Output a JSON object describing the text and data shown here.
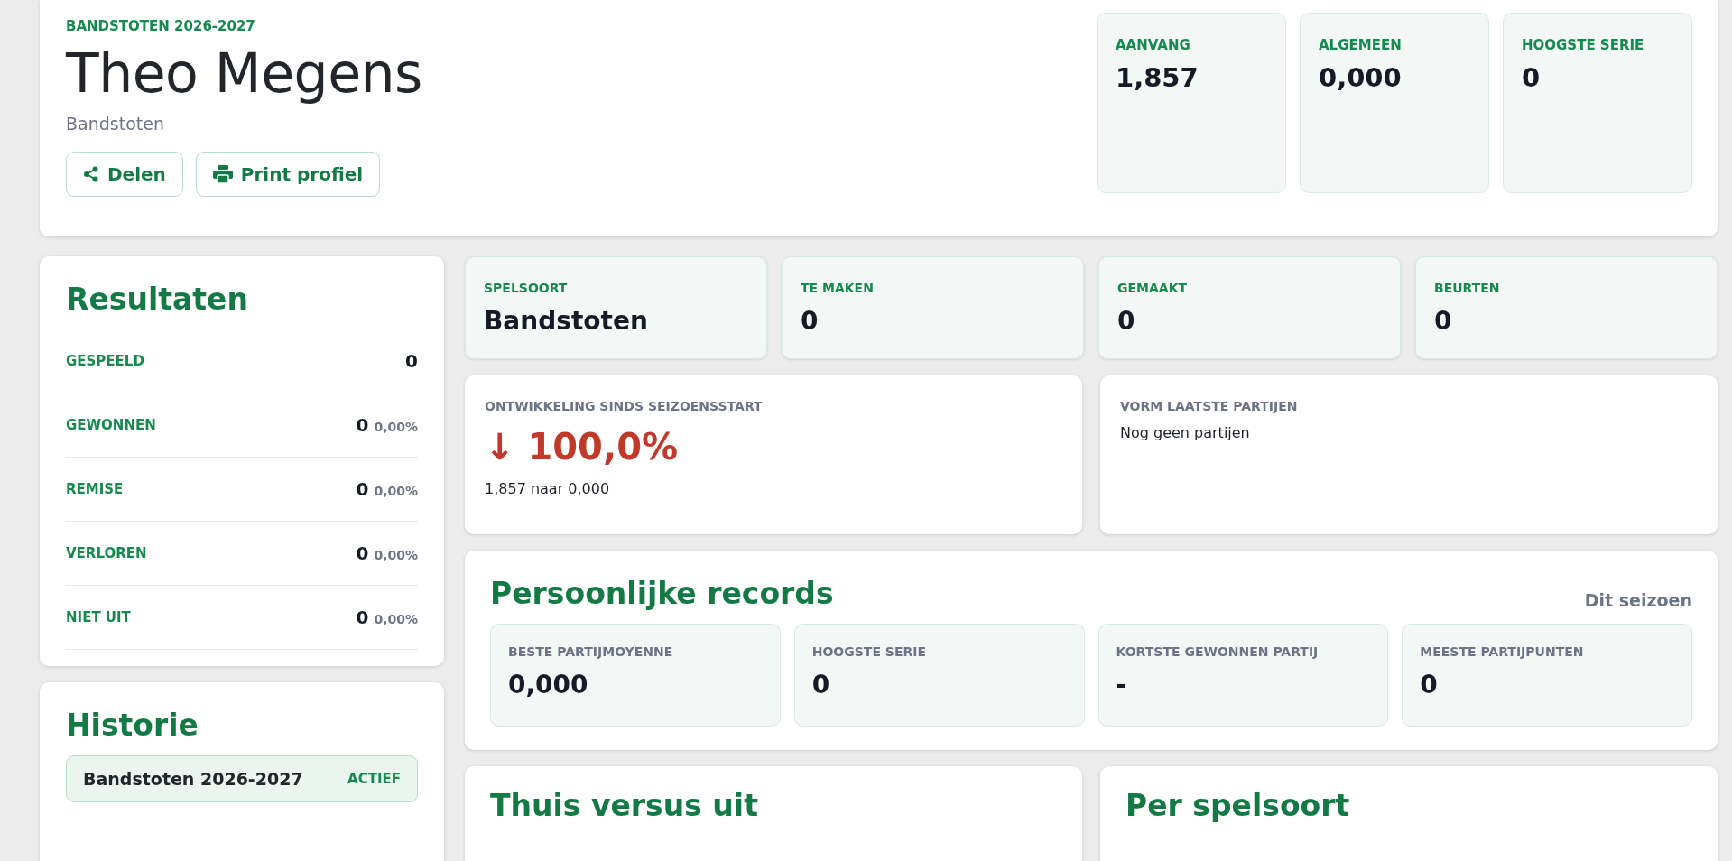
{
  "profile": {
    "season_label": "BANDSTOTEN 2026-2027",
    "name": "Theo Megens",
    "discipline": "Bandstoten",
    "buttons": [
      {
        "kind": "share",
        "label": "Delen"
      },
      {
        "kind": "print",
        "label": "Print profiel"
      }
    ],
    "stats": [
      {
        "label": "AANVANG",
        "value": "1,857"
      },
      {
        "label": "ALGEMEEN",
        "value": "0,000"
      },
      {
        "label": "HOOGSTE SERIE",
        "value": "0"
      }
    ]
  },
  "results": {
    "title": "Resultaten",
    "rows": [
      {
        "label": "GESPEELD",
        "value": "0"
      },
      {
        "label": "GEWONNEN",
        "value": "0",
        "percent": "0,00%"
      },
      {
        "label": "REMISE",
        "value": "0",
        "percent": "0,00%"
      },
      {
        "label": "VERLOREN",
        "value": "0",
        "percent": "0,00%"
      },
      {
        "label": "NIET UIT",
        "value": "0",
        "percent": "0,00%"
      }
    ]
  },
  "history": {
    "title": "Historie",
    "items": [
      {
        "label": "Bandstoten 2026-2027",
        "badge": "ACTIEF"
      }
    ]
  },
  "summary": [
    {
      "label": "SPELSOORT",
      "value": "Bandstoten"
    },
    {
      "label": "TE MAKEN",
      "value": "0"
    },
    {
      "label": "GEMAAKT",
      "value": "0"
    },
    {
      "label": "BEURTEN",
      "value": "0"
    }
  ],
  "development": {
    "title": "ONTWIKKELING SINDS SEIZOENSSTART",
    "arrow": "↓",
    "value": "100,0%",
    "detail": "1,857 naar 0,000"
  },
  "form": {
    "title": "VORM LAATSTE PARTIJEN",
    "empty_text": "Nog geen partijen"
  },
  "records": {
    "title": "Persoonlijke records",
    "filter": "Dit seizoen",
    "items": [
      {
        "label": "BESTE PARTIJMOYENNE",
        "value": "0,000"
      },
      {
        "label": "HOOGSTE SERIE",
        "value": "0"
      },
      {
        "label": "KORTSTE GEWONNEN PARTIJ",
        "value": "-"
      },
      {
        "label": "MEESTE PARTIJPUNTEN",
        "value": "0"
      }
    ]
  },
  "bottom_cards": [
    {
      "title": "Thuis versus uit"
    },
    {
      "title": "Per spelsoort"
    }
  ]
}
